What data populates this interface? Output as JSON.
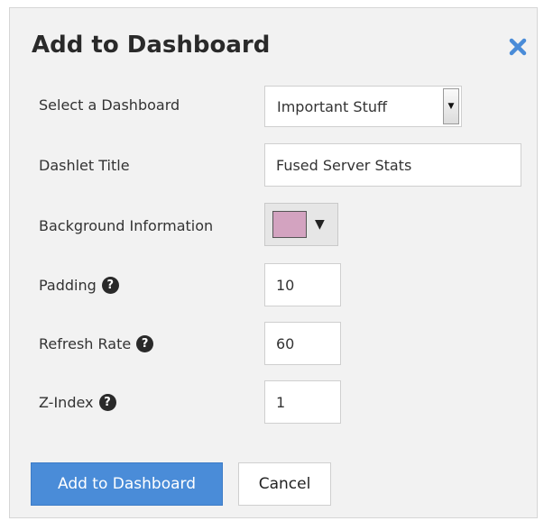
{
  "dialog": {
    "title": "Add to Dashboard",
    "close_icon": "close-x-icon"
  },
  "form": {
    "dashboard": {
      "label": "Select a Dashboard",
      "selected": "Important Stuff"
    },
    "dashlet_title": {
      "label": "Dashlet Title",
      "value": "Fused Server Stats"
    },
    "background": {
      "label": "Background Information",
      "color": "#d3a3c0"
    },
    "padding": {
      "label": "Padding",
      "value": "10",
      "help_icon": "question-circle-icon"
    },
    "refresh_rate": {
      "label": "Refresh Rate",
      "value": "60",
      "help_icon": "question-circle-icon"
    },
    "z_index": {
      "label": "Z-Index",
      "value": "1",
      "help_icon": "question-circle-icon"
    }
  },
  "buttons": {
    "submit_label": "Add to Dashboard",
    "cancel_label": "Cancel"
  },
  "colors": {
    "primary": "#4a8cd8",
    "close": "#4a8cd8"
  }
}
